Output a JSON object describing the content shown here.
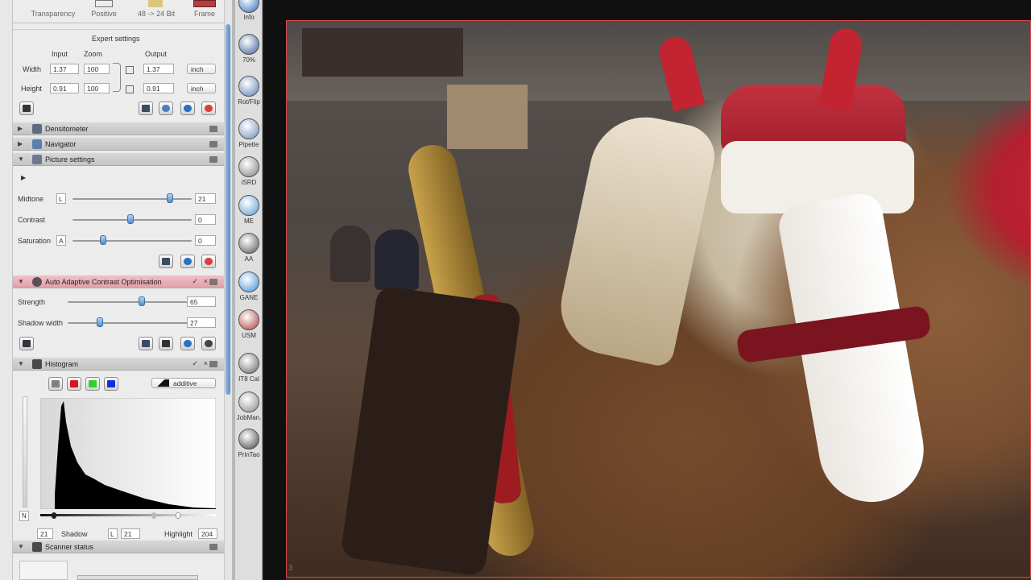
{
  "top_buttons": [
    {
      "label": "Transparency"
    },
    {
      "label": "Positive"
    },
    {
      "label": "48 -> 24 Bit"
    },
    {
      "label": "Frame"
    }
  ],
  "expert": {
    "title": "Expert settings",
    "col_input": "Input",
    "col_zoom": "Zoom",
    "col_output": "Output",
    "width_label": "Width",
    "height_label": "Height",
    "width_input": "1.37",
    "width_zoom": "100",
    "width_output": "1.37",
    "width_unit": "inch",
    "height_input": "0.91",
    "height_zoom": "100",
    "height_output": "0.91",
    "height_unit": "inch"
  },
  "sections": {
    "densitometer": "Densitometer",
    "navigator": "Navigator",
    "picture_settings": "Picture settings",
    "aaco": "Auto Adaptive Contrast Optimisation",
    "histogram": "Histogram",
    "scanner_status": "Scanner status"
  },
  "picture": {
    "midtone_label": "Midtone",
    "midtone_channel": "L",
    "midtone_value": "21",
    "contrast_label": "Contrast",
    "contrast_value": "0",
    "saturation_label": "Saturation",
    "saturation_channel": "A",
    "saturation_value": "0"
  },
  "aaco": {
    "strength_label": "Strength",
    "strength_value": "65",
    "shadow_label": "Shadow width",
    "shadow_value": "27"
  },
  "histogram": {
    "mode": "additive",
    "channel_colors": [
      "#808080",
      "#e01020",
      "#30d030",
      "#1030e0"
    ],
    "n_label": "N",
    "shadow_label": "Shadow",
    "shadow_left_value": "21",
    "shadow_channel": "L",
    "shadow_value": "21",
    "highlight_label": "Highlight",
    "highlight_value": "204"
  },
  "toolbar": [
    {
      "label": "Info",
      "icon": "info-icon"
    },
    {
      "label": "70%",
      "icon": "zoom-icon"
    },
    {
      "label": "Rot/Flip",
      "icon": "rotate-flip-icon"
    },
    {
      "label": "Pipette",
      "icon": "pipette-icon"
    },
    {
      "label": "iSRD",
      "icon": "isrd-icon"
    },
    {
      "label": "ME",
      "icon": "multi-exposure-icon"
    },
    {
      "label": "AA",
      "icon": "aaco-icon"
    },
    {
      "label": "GANE",
      "icon": "gane-icon"
    },
    {
      "label": "USM",
      "icon": "usm-icon"
    },
    {
      "label": "IT8 Cal",
      "icon": "it8-calibration-icon"
    },
    {
      "label": "JobMan.",
      "icon": "job-manager-icon"
    },
    {
      "label": "PrinTao",
      "icon": "printao-icon"
    }
  ],
  "viewer": {
    "frame_number": "3"
  }
}
